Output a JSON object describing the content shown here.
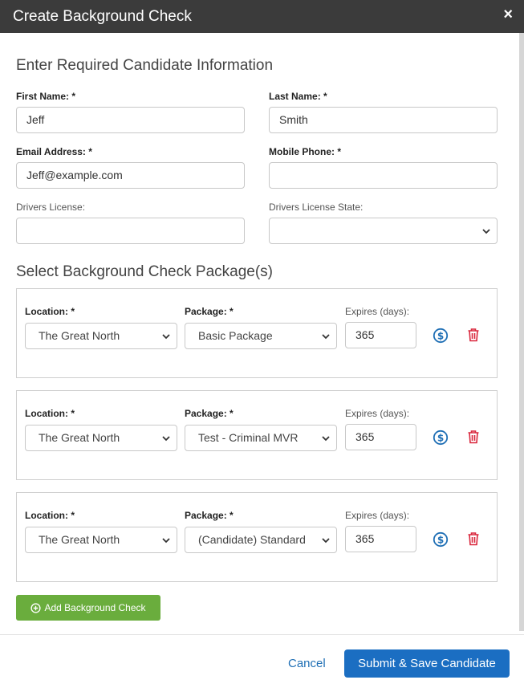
{
  "modal": {
    "title": "Create Background Check",
    "close_glyph": "×"
  },
  "candidate": {
    "section_title": "Enter Required Candidate Information",
    "first_name": {
      "label": "First Name: *",
      "value": "Jeff"
    },
    "last_name": {
      "label": "Last Name: *",
      "value": "Smith"
    },
    "email": {
      "label": "Email Address: *",
      "value": "Jeff@example.com"
    },
    "mobile": {
      "label": "Mobile Phone: *",
      "value": ""
    },
    "license": {
      "label": "Drivers License:",
      "value": ""
    },
    "license_state": {
      "label": "Drivers License State:",
      "value": ""
    }
  },
  "packages": {
    "section_title": "Select Background Check Package(s)",
    "location_label": "Location: *",
    "package_label": "Package: *",
    "expires_label": "Expires (days):",
    "items": [
      {
        "location": "The Great North",
        "package": "Basic Package",
        "expires": "365"
      },
      {
        "location": "The Great North",
        "package": "Test - Criminal MVR",
        "expires": "365"
      },
      {
        "location": "The Great North",
        "package": "(Candidate) Standard",
        "expires": "365"
      }
    ],
    "add_button": "Add Background Check"
  },
  "footer": {
    "cancel": "Cancel",
    "submit": "Submit & Save Candidate"
  },
  "colors": {
    "header": "#3b3b3b",
    "accent": "#1b6ec2",
    "add": "#6aad3d",
    "delete": "#d9263c",
    "price": "#1f6fb5"
  },
  "icons": [
    "close-icon",
    "dollar-circle-icon",
    "trash-icon",
    "plus-circle-icon",
    "chevron-down-icon"
  ]
}
